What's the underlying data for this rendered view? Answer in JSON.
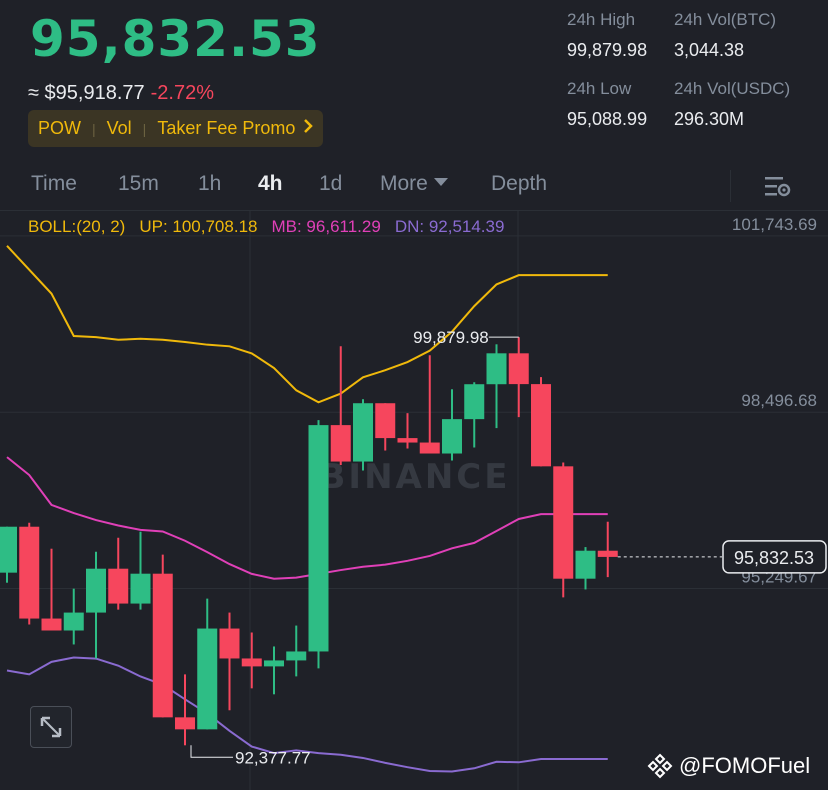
{
  "header": {
    "last_price": "95,832.53",
    "fiat_price": "≈ $95,918.77",
    "change_pct": "-2.72%",
    "tags": [
      "POW",
      "Vol",
      "Taker Fee Promo"
    ],
    "stats": {
      "high_label": "24h High",
      "high_value": "99,879.98",
      "vol_btc_label": "24h Vol(BTC)",
      "vol_btc_value": "3,044.38",
      "low_label": "24h Low",
      "low_value": "95,088.99",
      "vol_usdc_label": "24h Vol(USDC)",
      "vol_usdc_value": "296.30M"
    }
  },
  "tabs": {
    "items": [
      "Time",
      "15m",
      "1h",
      "4h",
      "1d",
      "More",
      "Depth"
    ],
    "active": "4h"
  },
  "indicator": {
    "name": "BOLL:(20, 2)",
    "up": "UP: 100,708.18",
    "mb": "MB: 96,611.29",
    "dn": "DN: 92,514.39"
  },
  "watermark": {
    "brand": "BINANCE",
    "user": "@FOMOFuel"
  },
  "colors": {
    "up": "#2ebd85",
    "down": "#f6465d",
    "boll_up": "#f0b90b",
    "boll_mb": "#e040b8",
    "boll_dn": "#8a6bd1",
    "tag": "#f0b90b"
  },
  "chart_data": {
    "type": "candlestick",
    "interval": "4h",
    "y_axis_labels": [
      "101,743.69",
      "98,496.68",
      "95,249.67"
    ],
    "y_axis_values": [
      101743.69,
      98496.68,
      95249.67
    ],
    "ylim": [
      91540,
      102220
    ],
    "current_price_label": "95,832.53",
    "current_price": 95832.53,
    "high_marker_label": "99,879.98",
    "low_marker_label": "92,377.77",
    "candles": [
      {
        "o": 95542,
        "h": 96277,
        "l": 95357,
        "c": 96388
      },
      {
        "o": 96388,
        "h": 96461,
        "l": 94587,
        "c": 94697
      },
      {
        "o": 94697,
        "h": 95983,
        "l": 94513,
        "c": 94477
      },
      {
        "o": 94477,
        "h": 95247,
        "l": 94220,
        "c": 94807
      },
      {
        "o": 94807,
        "h": 95927,
        "l": 93962,
        "c": 95615
      },
      {
        "o": 95615,
        "h": 96185,
        "l": 94862,
        "c": 94973
      },
      {
        "o": 94973,
        "h": 96296,
        "l": 94862,
        "c": 95523
      },
      {
        "o": 95523,
        "h": 95873,
        "l": 93485,
        "c": 92878
      },
      {
        "o": 92878,
        "h": 93669,
        "l": 92363,
        "c": 92657
      },
      {
        "o": 92657,
        "h": 95064,
        "l": 92657,
        "c": 94513
      },
      {
        "o": 94513,
        "h": 94807,
        "l": 93008,
        "c": 93962
      },
      {
        "o": 93962,
        "h": 94440,
        "l": 93412,
        "c": 93816
      },
      {
        "o": 93816,
        "h": 94183,
        "l": 93302,
        "c": 93926
      },
      {
        "o": 93926,
        "h": 94568,
        "l": 93632,
        "c": 94091
      },
      {
        "o": 94091,
        "h": 98350,
        "l": 93779,
        "c": 98259
      },
      {
        "o": 98259,
        "h": 99710,
        "l": 97524,
        "c": 97588
      },
      {
        "o": 97588,
        "h": 98736,
        "l": 97423,
        "c": 98662
      },
      {
        "o": 98662,
        "h": 98626,
        "l": 97791,
        "c": 98020
      },
      {
        "o": 98020,
        "h": 98479,
        "l": 97828,
        "c": 97938
      },
      {
        "o": 97938,
        "h": 99545,
        "l": 97864,
        "c": 97736
      },
      {
        "o": 97736,
        "h": 98919,
        "l": 97607,
        "c": 98369
      },
      {
        "o": 98369,
        "h": 99049,
        "l": 97846,
        "c": 99012
      },
      {
        "o": 99012,
        "h": 99747,
        "l": 98204,
        "c": 99581
      },
      {
        "o": 99581,
        "h": 99880,
        "l": 98406,
        "c": 99014
      },
      {
        "o": 99014,
        "h": 99143,
        "l": 97500,
        "c": 97500
      },
      {
        "o": 97500,
        "h": 97570,
        "l": 95088,
        "c": 95431
      },
      {
        "o": 95431,
        "h": 96013,
        "l": 95233,
        "c": 95946
      },
      {
        "o": 95946,
        "h": 96480,
        "l": 95460,
        "c": 95832
      }
    ],
    "boll_up": [
      {
        "x": 0,
        "y": 101560
      },
      {
        "x": 2,
        "y": 100680
      },
      {
        "x": 3,
        "y": 99900
      },
      {
        "x": 4,
        "y": 99880
      },
      {
        "x": 5,
        "y": 99830
      },
      {
        "x": 6,
        "y": 99850
      },
      {
        "x": 7,
        "y": 99830
      },
      {
        "x": 8,
        "y": 99790
      },
      {
        "x": 9,
        "y": 99740
      },
      {
        "x": 10,
        "y": 99710
      },
      {
        "x": 11,
        "y": 99580
      },
      {
        "x": 12,
        "y": 99310
      },
      {
        "x": 13,
        "y": 98900
      },
      {
        "x": 14,
        "y": 98680
      },
      {
        "x": 15,
        "y": 98840
      },
      {
        "x": 16,
        "y": 99140
      },
      {
        "x": 17,
        "y": 99270
      },
      {
        "x": 18,
        "y": 99420
      },
      {
        "x": 19,
        "y": 99630
      },
      {
        "x": 20,
        "y": 99980
      },
      {
        "x": 21,
        "y": 100450
      },
      {
        "x": 22,
        "y": 100850
      },
      {
        "x": 23,
        "y": 101020
      },
      {
        "x": 24,
        "y": 101020
      },
      {
        "x": 25,
        "y": 101020
      },
      {
        "x": 26,
        "y": 101020
      },
      {
        "x": 27,
        "y": 101020
      }
    ],
    "boll_mb": [
      {
        "x": 0,
        "y": 97670
      },
      {
        "x": 1,
        "y": 97340
      },
      {
        "x": 2,
        "y": 96790
      },
      {
        "x": 3,
        "y": 96640
      },
      {
        "x": 4,
        "y": 96510
      },
      {
        "x": 5,
        "y": 96410
      },
      {
        "x": 6,
        "y": 96330
      },
      {
        "x": 7,
        "y": 96300
      },
      {
        "x": 8,
        "y": 96130
      },
      {
        "x": 9,
        "y": 95920
      },
      {
        "x": 10,
        "y": 95700
      },
      {
        "x": 11,
        "y": 95520
      },
      {
        "x": 12,
        "y": 95430
      },
      {
        "x": 13,
        "y": 95450
      },
      {
        "x": 14,
        "y": 95520
      },
      {
        "x": 15,
        "y": 95590
      },
      {
        "x": 16,
        "y": 95650
      },
      {
        "x": 17,
        "y": 95690
      },
      {
        "x": 18,
        "y": 95760
      },
      {
        "x": 19,
        "y": 95850
      },
      {
        "x": 20,
        "y": 95990
      },
      {
        "x": 21,
        "y": 96090
      },
      {
        "x": 22,
        "y": 96310
      },
      {
        "x": 23,
        "y": 96530
      },
      {
        "x": 24,
        "y": 96620
      },
      {
        "x": 25,
        "y": 96620
      },
      {
        "x": 26,
        "y": 96620
      },
      {
        "x": 27,
        "y": 96620
      }
    ],
    "boll_dn": [
      {
        "x": 0,
        "y": 93740
      },
      {
        "x": 1,
        "y": 93670
      },
      {
        "x": 2,
        "y": 93900
      },
      {
        "x": 3,
        "y": 93980
      },
      {
        "x": 4,
        "y": 93960
      },
      {
        "x": 5,
        "y": 93830
      },
      {
        "x": 6,
        "y": 93630
      },
      {
        "x": 7,
        "y": 93480
      },
      {
        "x": 8,
        "y": 93210
      },
      {
        "x": 9,
        "y": 92950
      },
      {
        "x": 10,
        "y": 92630
      },
      {
        "x": 11,
        "y": 92340
      },
      {
        "x": 12,
        "y": 92220
      },
      {
        "x": 13,
        "y": 92270
      },
      {
        "x": 14,
        "y": 92220
      },
      {
        "x": 15,
        "y": 92190
      },
      {
        "x": 16,
        "y": 92130
      },
      {
        "x": 17,
        "y": 92040
      },
      {
        "x": 18,
        "y": 91960
      },
      {
        "x": 19,
        "y": 91890
      },
      {
        "x": 20,
        "y": 91880
      },
      {
        "x": 21,
        "y": 91940
      },
      {
        "x": 22,
        "y": 92060
      },
      {
        "x": 23,
        "y": 92050
      },
      {
        "x": 24,
        "y": 92110
      },
      {
        "x": 25,
        "y": 92110
      },
      {
        "x": 26,
        "y": 92110
      },
      {
        "x": 27,
        "y": 92110
      }
    ]
  }
}
